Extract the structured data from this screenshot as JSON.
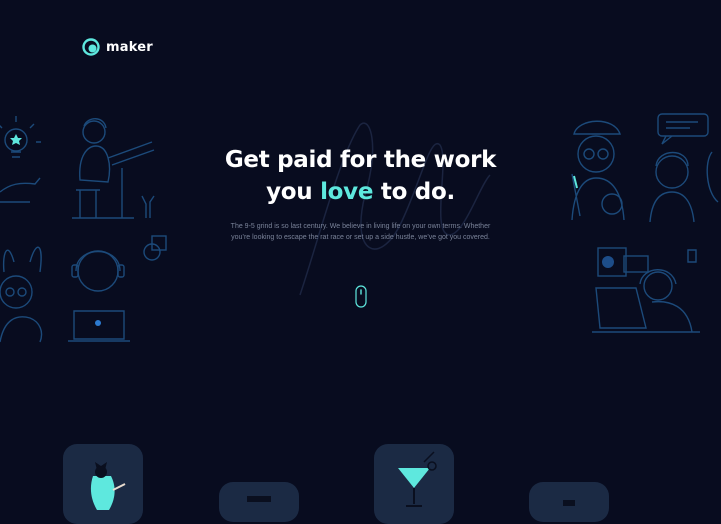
{
  "brand": {
    "name": "maker",
    "logo_icon": "maker-logo-icon"
  },
  "hero": {
    "title_line1": "Get paid for the work",
    "title_pre": "you ",
    "title_accent": "love",
    "title_post": " to do.",
    "subtitle": "The 9-5 grind is so last century. We believe in living life on your own terms. Whether you’re looking to escape the rat race or set up a side hustle, we’ve got you covered."
  },
  "colors": {
    "background": "#080c1f",
    "accent": "#5ee8de",
    "line_art": "#1c4a7a",
    "card": "#1b2a44"
  },
  "icons": [
    "mouse-scroll-icon",
    "lightbulb-icon",
    "cocktail-glass-icon"
  ]
}
